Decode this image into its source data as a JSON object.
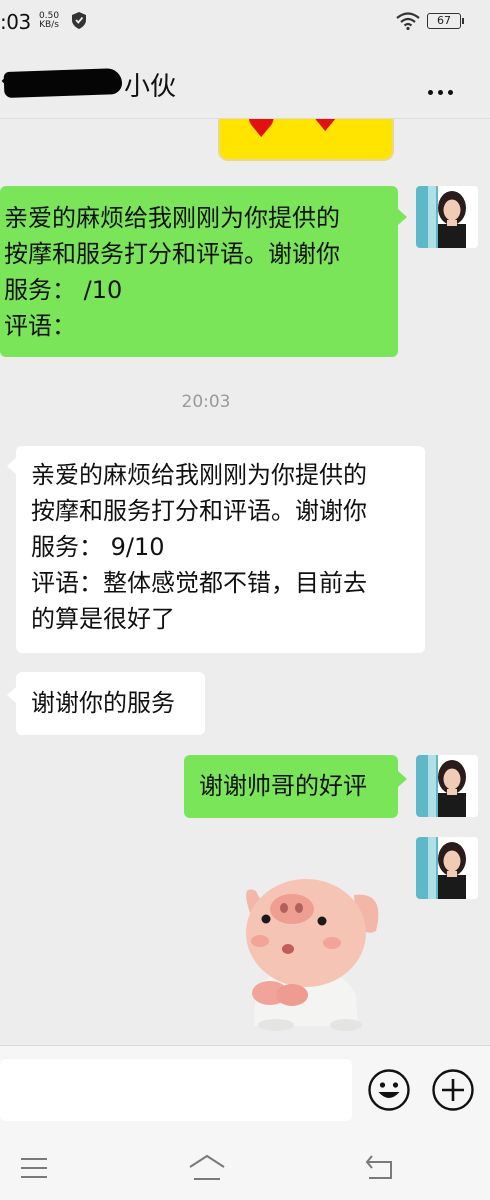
{
  "status_bar": {
    "time": ":03",
    "net_speed_value": "0.50",
    "net_speed_unit": "KB/s",
    "battery": "67"
  },
  "nav": {
    "title_visible": "小伙",
    "back_glyph": "‹"
  },
  "messages": [
    {
      "side": "right",
      "type": "text",
      "lines": [
        "亲爱的麻烦给我刚刚为你提供的",
        "按摩和服务打分和评语。谢谢你",
        "服务：  /10",
        "评语："
      ]
    },
    {
      "type": "timestamp",
      "text": "20:03"
    },
    {
      "side": "left",
      "type": "text",
      "lines": [
        "亲爱的麻烦给我刚刚为你提供的",
        "按摩和服务打分和评语。谢谢你",
        "服务：  9/10",
        "评语：整体感觉都不错，目前去",
        "的算是很好了"
      ]
    },
    {
      "side": "left",
      "type": "text",
      "lines": [
        "谢谢你的服务"
      ]
    },
    {
      "side": "right",
      "type": "text",
      "lines": [
        "谢谢帅哥的好评"
      ]
    },
    {
      "side": "right",
      "type": "sticker",
      "sticker": "pig-sticker"
    }
  ],
  "input_bar": {
    "emoji_icon": "smiley-face-icon",
    "plus_icon": "plus-circle-icon"
  },
  "colors": {
    "background": "#ededed",
    "sent_bubble": "#7be55a",
    "received_bubble": "#ffffff",
    "timestamp": "#9a9a9a"
  }
}
